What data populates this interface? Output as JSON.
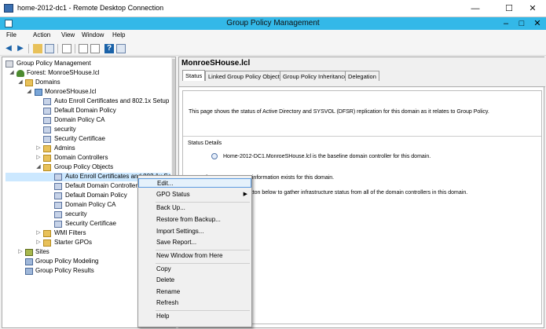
{
  "rdc": {
    "title": "home-2012-dc1 - Remote Desktop Connection",
    "min": "—",
    "max": "☐",
    "close": "✕"
  },
  "gpm": {
    "title": "Group Policy Management",
    "min": "–",
    "max": "□",
    "close": "✕"
  },
  "menu": [
    "File",
    "Action",
    "View",
    "Window",
    "Help"
  ],
  "tree": {
    "root": "Group Policy Management",
    "forest": "Forest: MonroeSHouse.lcl",
    "domains": "Domains",
    "domain": "MonroeSHouse.lcl",
    "items": [
      "Auto Enroll Certificates and 802.1x Setup",
      "Default Domain Policy",
      "Domain Policy CA",
      "security",
      "Security Certificae",
      "Admins",
      "Domain Controllers",
      "Group Policy Objects",
      "Auto Enroll Certificates and 802.1x Setup",
      "Default Domain Controller",
      "Default Domain Policy",
      "Domain Policy CA",
      "security",
      "Security Certificae",
      "WMI Filters",
      "Starter GPOs",
      "Sites",
      "Group Policy Modeling",
      "Group Policy Results"
    ]
  },
  "right": {
    "domain_title": "MonroeSHouse.lcl",
    "tabs": [
      "Status",
      "Linked Group Policy Objects",
      "Group Policy Inheritance",
      "Delegation"
    ],
    "intro": "This page shows the status of Active Directory and SYSVOL (DFSR) replication for this domain as it relates to Group Policy.",
    "status_details": "Status Details",
    "baseline": "Home-2012-DC1.MonroeSHouse.lcl is the baseline domain controller for this domain.",
    "no_infra": "No Infrastructure Status information exists for this domain.",
    "click_detect": "Click the Detect Now button below to gather infrastructure status from all of the domain controllers in this domain."
  },
  "context_menu": {
    "items": [
      "Edit...",
      "GPO Status",
      "Back Up...",
      "Restore from Backup...",
      "Import Settings...",
      "Save Report...",
      "New Window from Here",
      "Copy",
      "Delete",
      "Rename",
      "Refresh",
      "Help"
    ],
    "submenu_arrow": "▶"
  },
  "icons": {
    "back": "back-arrow-icon",
    "forward": "forward-arrow-icon"
  }
}
